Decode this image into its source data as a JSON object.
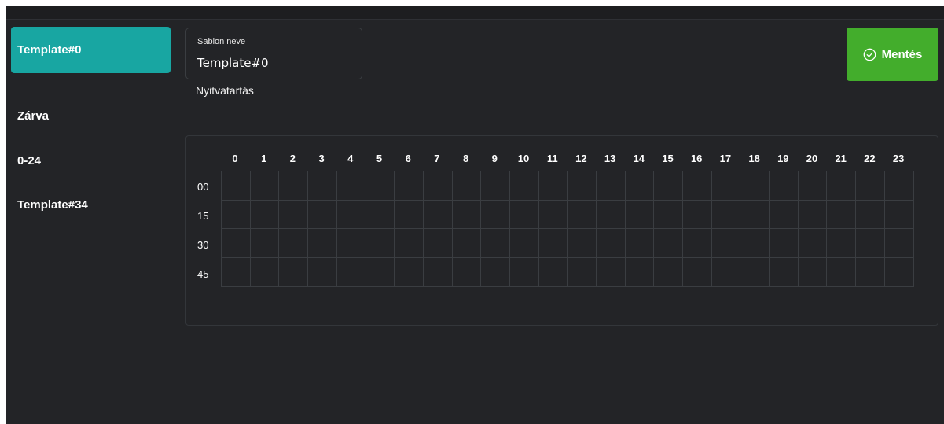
{
  "sidebar": {
    "items": [
      {
        "label": "Template#0",
        "active": true
      },
      {
        "label": "Zárva",
        "active": false
      },
      {
        "label": "0-24",
        "active": false
      },
      {
        "label": "Template#34",
        "active": false
      }
    ]
  },
  "template_name": {
    "label": "Sablon neve",
    "value": "Template#0"
  },
  "save_button": {
    "label": "Mentés",
    "icon": "check-circle-icon",
    "color": "#43ad2c"
  },
  "schedule": {
    "title": "Nyitvatartás",
    "hours": [
      "0",
      "1",
      "2",
      "3",
      "4",
      "5",
      "6",
      "7",
      "8",
      "9",
      "10",
      "11",
      "12",
      "13",
      "14",
      "15",
      "16",
      "17",
      "18",
      "19",
      "20",
      "21",
      "22",
      "23"
    ],
    "quarters": [
      "00",
      "15",
      "30",
      "45"
    ]
  },
  "colors": {
    "accent": "#18a6a2",
    "background": "#232427",
    "save": "#43ad2c"
  }
}
